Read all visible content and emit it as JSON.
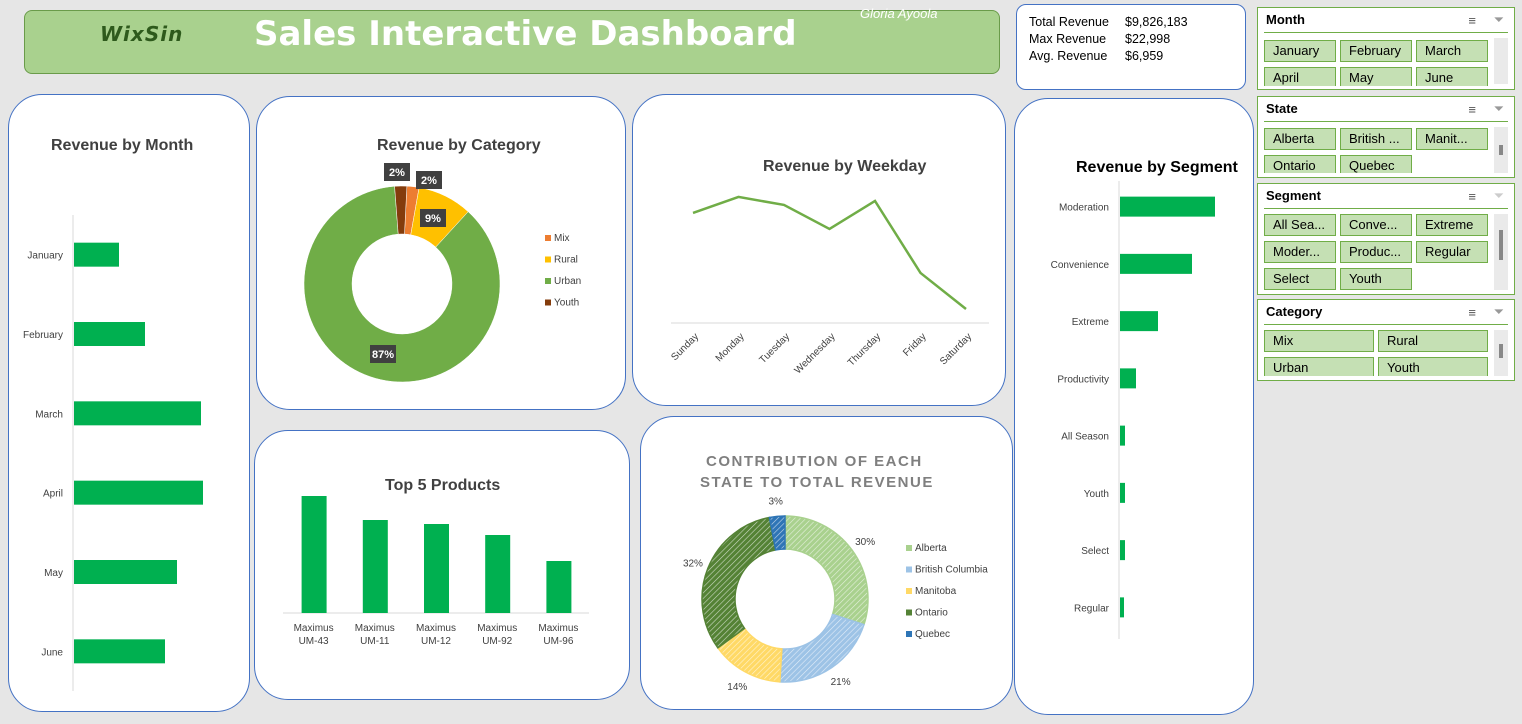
{
  "header": {
    "logo": "WixSin",
    "title": "Sales Interactive Dashboard",
    "author": "Gloria Ayoola"
  },
  "kpi": {
    "items": [
      {
        "label": "Total Revenue",
        "value": "$9,826,183"
      },
      {
        "label": "Max Revenue",
        "value": "$22,998"
      },
      {
        "label": "Avg. Revenue",
        "value": "$6,959"
      }
    ]
  },
  "colors": {
    "accent_green": "#00b050",
    "line_green": "#70ad47",
    "header_green": "#a9d18e",
    "panel_border": "#4472c4",
    "mix": "#ed7d31",
    "rural": "#ffc000",
    "urban": "#70ad47",
    "youth": "#843c0c"
  },
  "charts": {
    "month": {
      "title": "Revenue by Month"
    },
    "category": {
      "title": "Revenue by Category"
    },
    "weekday": {
      "title": "Revenue by Weekday"
    },
    "segment": {
      "title": "Revenue by Segment"
    },
    "products": {
      "title": "Top 5 Products"
    },
    "state": {
      "title_line1": "CONTRIBUTION OF EACH",
      "title_line2": "STATE TO TOTAL REVENUE"
    }
  },
  "chart_data": [
    {
      "type": "bar",
      "title": "Revenue by Month",
      "orientation": "horizontal",
      "categories": [
        "January",
        "February",
        "March",
        "April",
        "May",
        "June"
      ],
      "values": [
        45,
        71,
        127,
        129,
        103,
        91
      ],
      "grid": false
    },
    {
      "type": "pie",
      "title": "Revenue by Category",
      "categories": [
        "Mix",
        "Rural",
        "Urban",
        "Youth"
      ],
      "values": [
        2,
        9,
        87,
        2
      ],
      "data_labels": [
        "2%",
        "9%",
        "87%",
        "2%"
      ]
    },
    {
      "type": "line",
      "title": "Revenue by Weekday",
      "x": [
        "Sunday",
        "Monday",
        "Tuesday",
        "Wednesday",
        "Thursday",
        "Friday",
        "Saturday"
      ],
      "values": [
        70,
        78,
        74,
        62,
        76,
        40,
        22
      ]
    },
    {
      "type": "bar",
      "title": "Revenue by Segment",
      "orientation": "horizontal",
      "categories": [
        "Moderation",
        "Convenience",
        "Extreme",
        "Productivity",
        "All Season",
        "Youth",
        "Select",
        "Regular"
      ],
      "values": [
        95,
        72,
        38,
        16,
        5,
        5,
        5,
        4
      ],
      "grid": false
    },
    {
      "type": "bar",
      "title": "Top 5 Products",
      "categories": [
        "Maximus UM-43",
        "Maximus UM-11",
        "Maximus UM-12",
        "Maximus UM-92",
        "Maximus UM-96"
      ],
      "category_lines": [
        [
          "Maximus",
          "UM-43"
        ],
        [
          "Maximus",
          "UM-11"
        ],
        [
          "Maximus",
          "UM-12"
        ],
        [
          "Maximus",
          "UM-92"
        ],
        [
          "Maximus",
          "UM-96"
        ]
      ],
      "values": [
        117,
        93,
        89,
        78,
        52
      ]
    },
    {
      "type": "pie",
      "title": "CONTRIBUTION OF EACH STATE TO TOTAL REVENUE",
      "categories": [
        "Alberta",
        "British Columbia",
        "Manitoba",
        "Ontario",
        "Quebec"
      ],
      "values": [
        30,
        21,
        14,
        32,
        3
      ],
      "data_labels": [
        "30%",
        "21%",
        "14%",
        "32%",
        "3%"
      ],
      "colors": [
        "#a9d18e",
        "#9dc3e6",
        "#ffd966",
        "#548235",
        "#2e75b6"
      ]
    }
  ],
  "slicers": {
    "month": {
      "header": "Month",
      "items": [
        "January",
        "February",
        "March",
        "April",
        "May",
        "June"
      ]
    },
    "state": {
      "header": "State",
      "items": [
        "Alberta",
        "British ...",
        "Manit...",
        "Ontario",
        "Quebec"
      ]
    },
    "segment": {
      "header": "Segment",
      "items": [
        "All Sea...",
        "Conve...",
        "Extreme",
        "Moder...",
        "Produc...",
        "Regular",
        "Select",
        "Youth"
      ]
    },
    "category": {
      "header": "Category",
      "items": [
        "Mix",
        "Rural",
        "Urban",
        "Youth"
      ]
    }
  }
}
